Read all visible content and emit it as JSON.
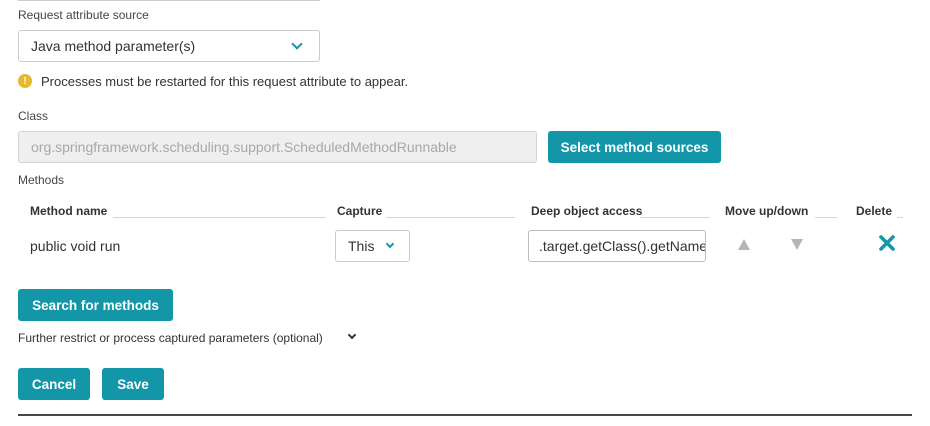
{
  "source": {
    "label": "Request attribute source",
    "value": "Java method parameter(s)"
  },
  "warning": {
    "icon": "info-circle-icon",
    "text": "Processes must be restarted for this request attribute to appear."
  },
  "class_field": {
    "label": "Class",
    "value": "org.springframework.scheduling.support.ScheduledMethodRunnable"
  },
  "select_sources_label": "Select method sources",
  "methods": {
    "label": "Methods",
    "headers": {
      "method_name": "Method name",
      "capture": "Capture",
      "deep_access": "Deep object access",
      "move": "Move up/down",
      "delete": "Delete"
    },
    "rows": [
      {
        "method_name": "public void run",
        "capture": "This",
        "deep_access": ".target.getClass().getName()"
      }
    ]
  },
  "search_methods_label": "Search for methods",
  "further_label": "Further restrict or process captured parameters (optional)",
  "cancel_label": "Cancel",
  "save_label": "Save",
  "colors": {
    "accent": "#1496a9",
    "warning": "#e5b931",
    "disabled_arrow": "#b5b5b5"
  }
}
